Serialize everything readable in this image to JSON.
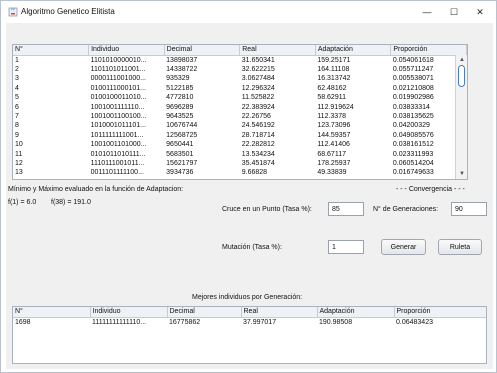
{
  "window": {
    "title": "Algoritmo Genetico Elitista",
    "minimize_glyph": "—",
    "maximize_glyph": "☐",
    "close_glyph": "✕",
    "icon": "java-cup-icon"
  },
  "population_table": {
    "columns": [
      "N°",
      "Individuo",
      "Decimal",
      "Real",
      "Adaptación",
      "Proporción"
    ],
    "rows": [
      [
        "1",
        "1101010000010...",
        "13898037",
        "31.650341",
        "159.25171",
        "0.054061618"
      ],
      [
        "2",
        "1101101011001...",
        "14338722",
        "32.622215",
        "164.11108",
        "0.055711247"
      ],
      [
        "3",
        "0000111001000...",
        "935329",
        "3.0627484",
        "16.313742",
        "0.005538071"
      ],
      [
        "4",
        "0100111000101...",
        "5122185",
        "12.296324",
        "62.48162",
        "0.021210808"
      ],
      [
        "5",
        "0100100011010...",
        "4772810",
        "11.525822",
        "58.62911",
        "0.019902986"
      ],
      [
        "6",
        "1001001111110...",
        "9696289",
        "22.383924",
        "112.919624",
        "0.03833314"
      ],
      [
        "7",
        "1001001100100...",
        "9643525",
        "22.26756",
        "112.3378",
        "0.038135625"
      ],
      [
        "8",
        "1010001011101...",
        "10676744",
        "24.546192",
        "123.73096",
        "0.04200329"
      ],
      [
        "9",
        "1011111111001...",
        "12568725",
        "28.718714",
        "144.59357",
        "0.049085576"
      ],
      [
        "10",
        "1001001101000...",
        "9650441",
        "22.282812",
        "112.41406",
        "0.038161512"
      ],
      [
        "11",
        "0101011010111...",
        "5683501",
        "13.534234",
        "68.67117",
        "0.023311993"
      ],
      [
        "12",
        "1110111001011...",
        "15621797",
        "35.451874",
        "178.25937",
        "0.060514204"
      ]
    ],
    "partial_row": [
      "13",
      "0011101111100...",
      "3934736",
      "9.66828",
      "49.33839",
      "0.016749633"
    ]
  },
  "stats": {
    "min_max_label": "Mínimo y Máximo evaluado en la función de Adaptacion:",
    "f_min": "f(1) = 6.0",
    "f_max": "f(38) = 191.0",
    "convergence_label": "- - - Convergencia - - -"
  },
  "controls": {
    "crossover_label": "Cruce en un Punto (Tasa %):",
    "crossover_value": "85",
    "generations_label": "N° de Generaciones:",
    "generations_value": "90",
    "mutation_label": "Mutación (Tasa %):",
    "mutation_value": "1",
    "generate_button": "Generar",
    "roulette_button": "Ruleta"
  },
  "best_table": {
    "caption": "Mejores individuos por Generación:",
    "columns": [
      "N°",
      "Individuo",
      "Decimal",
      "Real",
      "Adaptación",
      "Proporción"
    ],
    "rows": [
      [
        "1698",
        "11111111111110...",
        "16775862",
        "37.997017",
        "190.98508",
        "0.06483423"
      ]
    ]
  },
  "colors": {
    "panel_bg": "#f0f0f0",
    "table_header_bg": "#eef1f5",
    "scroll_thumb_border": "#4a7dc8"
  }
}
